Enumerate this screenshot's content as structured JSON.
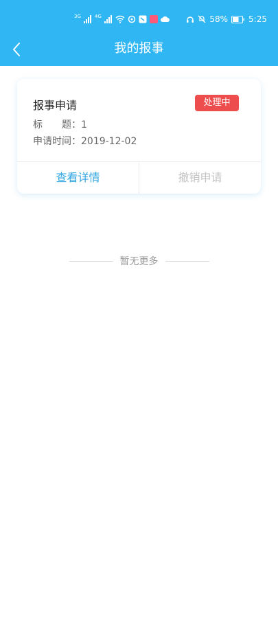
{
  "status_bar": {
    "network_left": "3G",
    "network_right": "4G",
    "battery": "58%",
    "time": "5:25"
  },
  "nav": {
    "title": "我的报事"
  },
  "card": {
    "title": "报事申请",
    "status": "处理中",
    "title_label": "标　　题：",
    "title_value": "1",
    "date_label": "申请时间：",
    "date_value": "2019-12-02",
    "detail_button": "查看详情",
    "cancel_button": "撤销申请"
  },
  "footer": {
    "no_more": "暂无更多"
  },
  "colors": {
    "header": "#2fb6f3",
    "accent": "#2fa6e0",
    "badge": "#ee4d4d"
  }
}
